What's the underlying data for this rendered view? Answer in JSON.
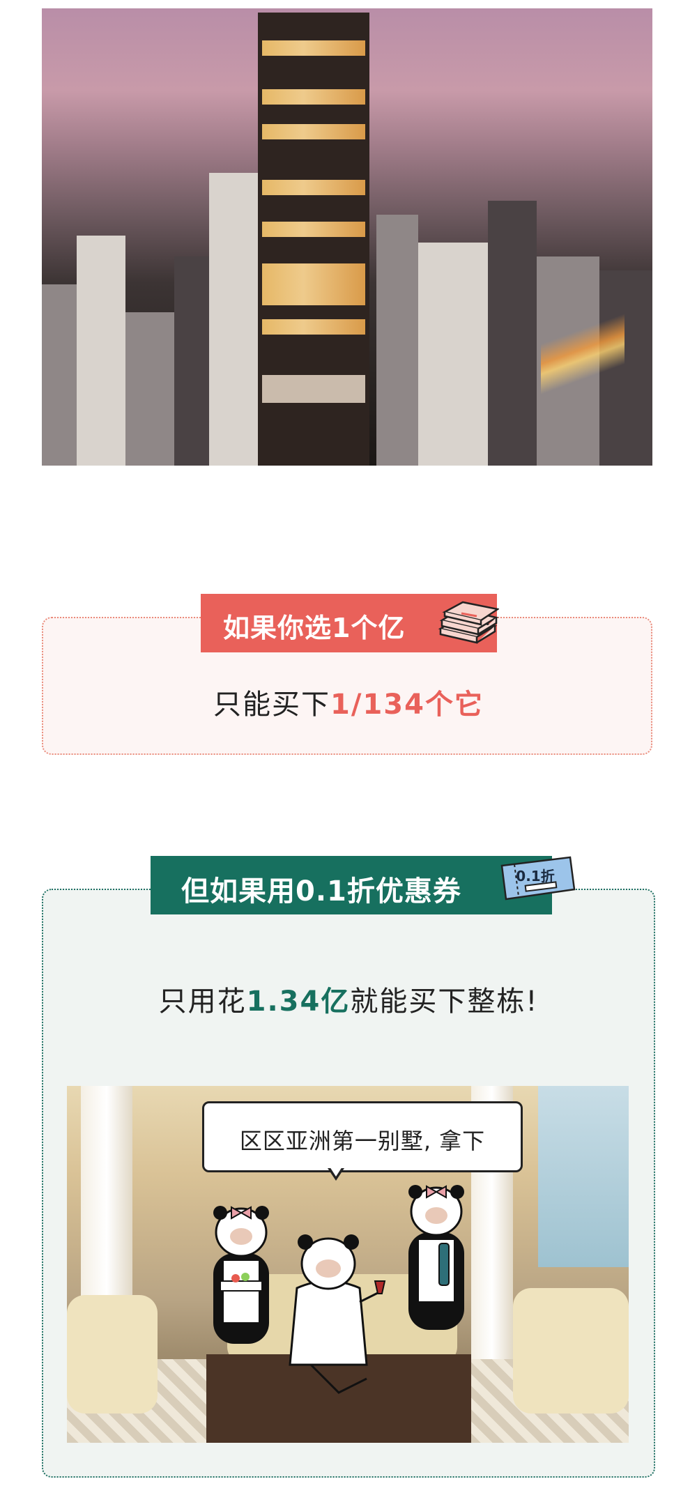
{
  "section1": {
    "tag": "如果你选1个亿",
    "text_prefix": "只能买下",
    "text_highlight": "1/134个它",
    "icon": "money-stack-icon",
    "accent_color": "#e9615a"
  },
  "section2": {
    "tag": "但如果用0.1折优惠券",
    "coupon_label": "0.1折",
    "text_prefix": "只用花",
    "text_highlight": "1.34亿",
    "text_suffix": "就能买下整栋!",
    "accent_color": "#17705f"
  },
  "bubble": {
    "text": "区区亚洲第一别墅, 拿下"
  }
}
